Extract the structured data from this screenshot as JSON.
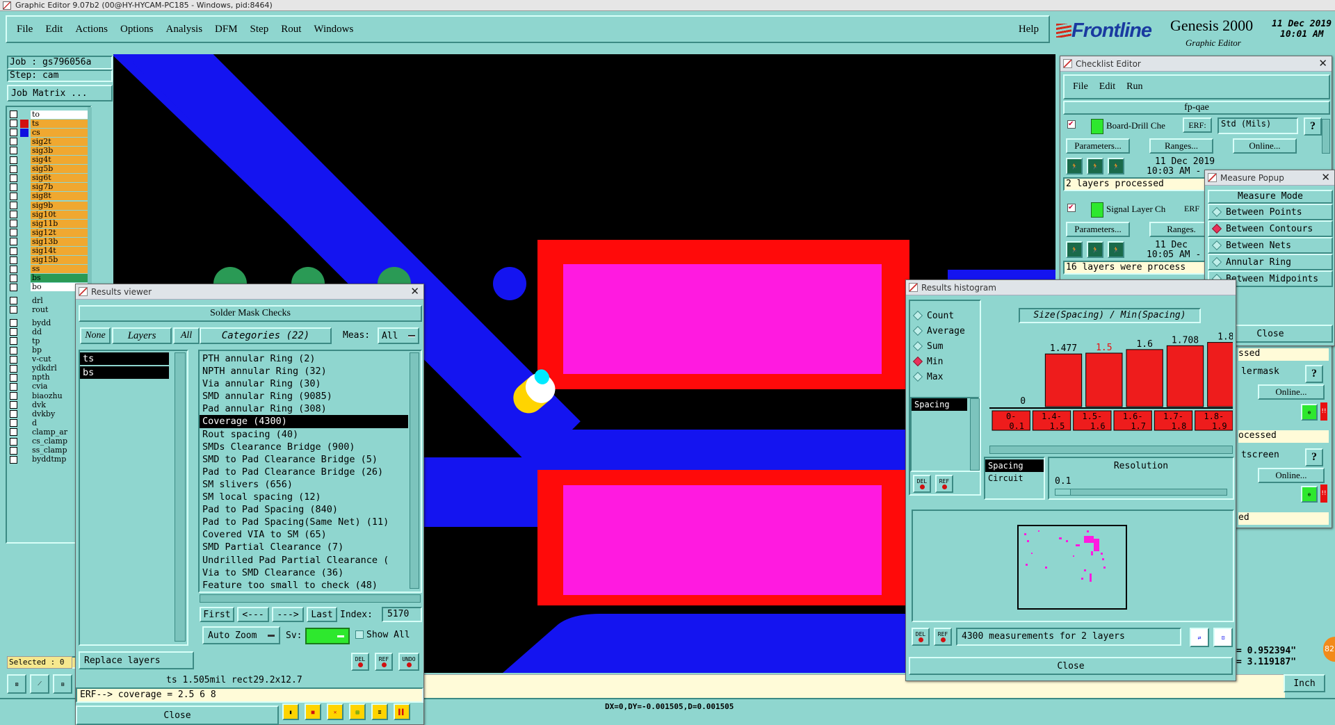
{
  "window_title": "Graphic Editor 9.07b2 (00@HY-HYCAM-PC185 - Windows, pid:8464)",
  "menu": [
    "File",
    "Edit",
    "Actions",
    "Options",
    "Analysis",
    "DFM",
    "Step",
    "Rout",
    "Windows"
  ],
  "help_label": "Help",
  "brand": {
    "logo": "Frontline",
    "product": "Genesis 2000",
    "sub": "Graphic Editor",
    "date": "11 Dec 2019",
    "time": "10:01 AM"
  },
  "job": {
    "job_label": "Job : gs796056a",
    "step_label": "Step: cam",
    "matrix_btn": "Job Matrix ..."
  },
  "layers": {
    "group1": [
      {
        "name": "to",
        "color": "#ffffff",
        "swatch": "#8fd6cf"
      },
      {
        "name": "ts",
        "color": "#f0a830",
        "swatch": "#d01010"
      },
      {
        "name": "cs",
        "color": "#f0a830",
        "swatch": "#1010e0"
      },
      {
        "name": "sig2t",
        "color": "#f0a830",
        "swatch": ""
      },
      {
        "name": "sig3b",
        "color": "#f0a830",
        "swatch": ""
      },
      {
        "name": "sig4t",
        "color": "#f0a830",
        "swatch": ""
      },
      {
        "name": "sig5b",
        "color": "#f0a830",
        "swatch": ""
      },
      {
        "name": "sig6t",
        "color": "#f0a830",
        "swatch": ""
      },
      {
        "name": "sig7b",
        "color": "#f0a830",
        "swatch": ""
      },
      {
        "name": "sig8t",
        "color": "#f0a830",
        "swatch": ""
      },
      {
        "name": "sig9b",
        "color": "#f0a830",
        "swatch": ""
      },
      {
        "name": "sig10t",
        "color": "#f0a830",
        "swatch": ""
      },
      {
        "name": "sig11b",
        "color": "#f0a830",
        "swatch": ""
      },
      {
        "name": "sig12t",
        "color": "#f0a830",
        "swatch": ""
      },
      {
        "name": "sig13b",
        "color": "#f0a830",
        "swatch": ""
      },
      {
        "name": "sig14t",
        "color": "#f0a830",
        "swatch": ""
      },
      {
        "name": "sig15b",
        "color": "#f0a830",
        "swatch": ""
      },
      {
        "name": "ss",
        "color": "#f0a830",
        "swatch": ""
      },
      {
        "name": "bs",
        "color": "#2a9a55",
        "swatch": ""
      },
      {
        "name": "bo",
        "color": "#ffffff",
        "swatch": ""
      }
    ],
    "group2": [
      "drl",
      "rout"
    ],
    "group3": [
      "bydd",
      "dd",
      "tp",
      "bp",
      "v-cut",
      "ydkdrl",
      "npth",
      "cvia",
      "biaozhu",
      "dvk",
      "dvkby",
      "d",
      "clamp_ar",
      "cs_clamp",
      "ss_clamp",
      "byddtmp"
    ],
    "selected_label": "Selected : 0"
  },
  "results_viewer": {
    "title": "Results viewer",
    "header": "Solder Mask Checks",
    "none_btn": "None",
    "layers_btn": "Layers",
    "all_btn": "All",
    "categories_btn": "Categories (22)",
    "meas_label": "Meas:",
    "meas_value": "All",
    "layers": [
      "ts",
      "bs"
    ],
    "categories": [
      "PTH annular Ring (2)",
      "NPTH annular Ring (32)",
      "Via annular Ring (30)",
      "SMD annular Ring (9085)",
      "Pad annular Ring (308)",
      "Coverage (4300)",
      "Rout spacing (40)",
      "SMDs Clearance Bridge (900)",
      "SMD to Pad Clearance Bridge (5)",
      "Pad to Pad Clearance Bridge (26)",
      "SM slivers (656)",
      "SM local spacing (12)",
      "Pad to Pad Spacing (840)",
      "Pad to Pad Spacing(Same Net) (11)",
      "Covered VIA to SM (65)",
      "SMD Partial Clearance (7)",
      "Undrilled Pad Partial Clearance (",
      "Via to SMD Clearance (36)",
      "Feature too small to check (48)"
    ],
    "selected_category": 5,
    "nav": {
      "first": "First",
      "prev": "<---",
      "next": "--->",
      "last": "Last",
      "index_label": "Index:",
      "index_value": "5170"
    },
    "auto_zoom": "Auto Zoom",
    "sv_label": "Sv:",
    "show_all": "Show All",
    "replace_layers": "Replace layers",
    "info": "ts 1.505mil  rect29.2x12.7",
    "erf_line": "ERF--> coverage = 2.5 6 8",
    "close": "Close"
  },
  "checklist": {
    "title": "Checklist Editor",
    "menu": [
      "File",
      "Edit",
      "Run"
    ],
    "name": "fp-qae",
    "items": [
      {
        "label": "Board-Drill Che",
        "erf": "ERF:",
        "erf_value": "Std (Mils)",
        "params": "Parameters...",
        "ranges": "Ranges...",
        "online": "Online...",
        "date": "11 Dec 2019",
        "time": "10:03 AM -",
        "status": "2 layers processed"
      },
      {
        "label": "Signal Layer Ch",
        "erf": "ERF",
        "params": "Parameters...",
        "ranges": "Ranges.",
        "date": "11 Dec",
        "time": "10:05 AM -",
        "status": "16 layers were process"
      }
    ],
    "partial": [
      "ssed",
      "lermask",
      "Online...",
      "ocessed",
      "tscreen",
      "Online...",
      "ed"
    ]
  },
  "measure": {
    "title": "Measure Popup",
    "mode_label": "Measure Mode",
    "options": [
      "Between Points",
      "Between Contours",
      "Between Nets",
      "Annular Ring",
      "Between Midpoints"
    ],
    "selected": 1,
    "close": "Close"
  },
  "histogram": {
    "title": "Results histogram",
    "options": [
      "Count",
      "Average",
      "Sum",
      "Min",
      "Max"
    ],
    "selected": 3,
    "list": [
      "Spacing"
    ],
    "formula": "Size(Spacing) / Min(Spacing)",
    "chart_data": {
      "type": "bar",
      "categories": [
        "0-0.1",
        "1.4-1.5",
        "1.5-1.6",
        "1.6-1.7",
        "1.7-1.8",
        "1.8-1.9"
      ],
      "values": [
        0,
        1.477,
        1.5,
        1.6,
        1.708,
        1.8
      ],
      "value_labels": [
        "0",
        "1.477",
        "1.5",
        "1.6",
        "1.708",
        "1.8"
      ],
      "ylim": [
        0,
        2.1
      ]
    },
    "bin_list": [
      "Spacing",
      "Circuit"
    ],
    "resolution_label": "Resolution",
    "resolution_value": "0.1",
    "measurements": "4300 measurements for 2 layers",
    "close": "Close"
  },
  "status": {
    "coords": "DX=0,DY=-0.001505,D=0.001505",
    "x": "= 0.952394\"",
    "y": "= 3.119187\"",
    "unit": "Inch",
    "badge": "82"
  },
  "btn_labels": {
    "del": "DEL",
    "ref": "REF",
    "undo": "UNDO"
  }
}
